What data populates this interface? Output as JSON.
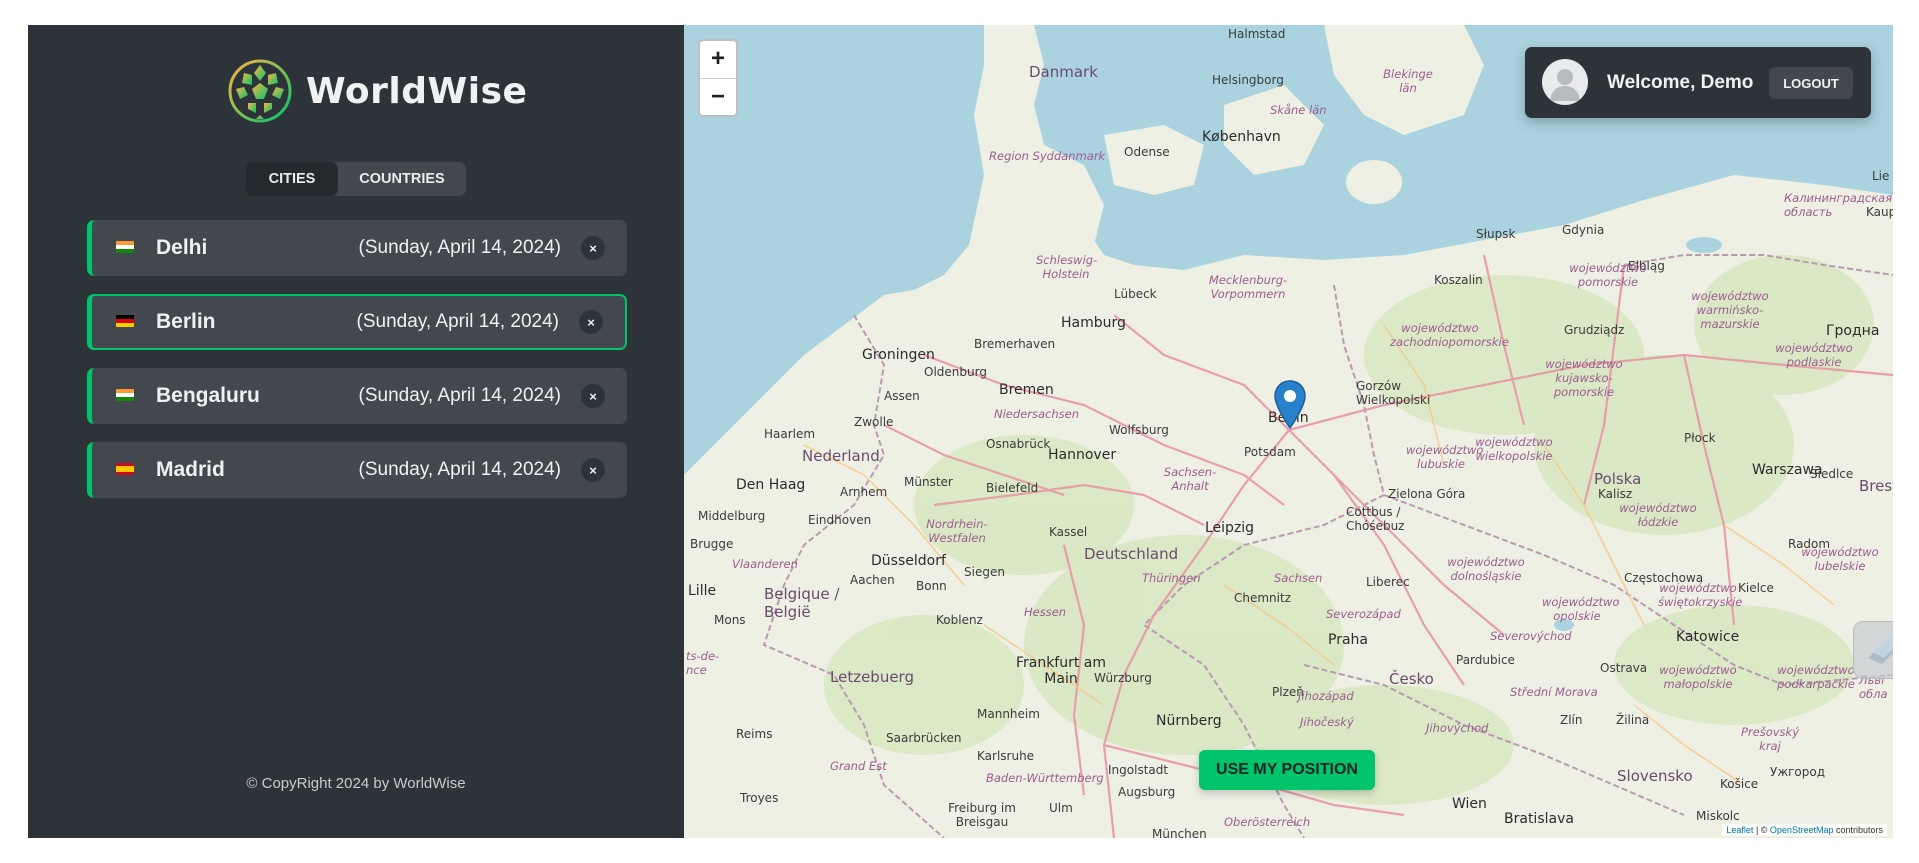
{
  "brand": {
    "name": "WorldWise",
    "logo_icon": "globe-logo-icon"
  },
  "tabs": [
    {
      "label": "Cities",
      "active": true
    },
    {
      "label": "Countries",
      "active": false
    }
  ],
  "cities": [
    {
      "name": "Delhi",
      "date": "(Sunday, April 14, 2024)",
      "flag": "in",
      "selected": false
    },
    {
      "name": "Berlin",
      "date": "(Sunday, April 14, 2024)",
      "flag": "de",
      "selected": true
    },
    {
      "name": "Bengaluru",
      "date": "(Sunday, April 14, 2024)",
      "flag": "in",
      "selected": false
    },
    {
      "name": "Madrid",
      "date": "(Sunday, April 14, 2024)",
      "flag": "es",
      "selected": false
    }
  ],
  "delete_symbol": "×",
  "footer": {
    "copyright": "© CopyRight 2024 by WorldWise"
  },
  "map": {
    "zoom_in": "+",
    "zoom_out": "−",
    "use_position": "Use my position",
    "attribution": {
      "leaflet": "Leaflet",
      "sep": " | © ",
      "osm": "OpenStreetMap",
      "suffix": " contributors"
    },
    "labels": {
      "countries": [
        "Danmark",
        "Nederland",
        "Deutschland",
        "Polska",
        "Belgique / België",
        "Letzebuerg",
        "Česko",
        "Slovensko",
        "Brest"
      ],
      "cities": [
        "København",
        "Hamburg",
        "Bremen",
        "Hannover",
        "Berlin",
        "Leipzig",
        "Praha",
        "Warszawa",
        "Wien",
        "Bratislava",
        "Katowice",
        "Düsseldorf",
        "Frankfurt am Main",
        "Den Haag",
        "Nürnberg",
        "Groningen",
        "Potsdam"
      ],
      "towns": [
        "Halmstad",
        "Helsingborg",
        "Odense",
        "Lübeck",
        "Bremerhaven",
        "Oldenburg",
        "Assen",
        "Zwolle",
        "Osnabrück",
        "Wolfsburg",
        "Haarlem",
        "Arnhem",
        "Münster",
        "Bielefeld",
        "Middelburg",
        "Eindhoven",
        "Kassel",
        "Brugge",
        "Aachen",
        "Bonn",
        "Siegen",
        "Lille",
        "Mons",
        "Koblenz",
        "Chemnitz",
        "Würzburg",
        "Mannheim",
        "Saarbrücken",
        "Karlsruhe",
        "Reims",
        "Troyes",
        "Freiburg im Breisgau",
        "Ulm",
        "Augsburg",
        "Ingolstadt",
        "München",
        "Plzeň",
        "Liberec",
        "Pardubice",
        "Ostrava",
        "Zlín",
        "Žilina",
        "Košice",
        "Ужгород",
        "Miskolc",
        "Radom",
        "Kielce",
        "Częstochowa",
        "Kalisz",
        "Płock",
        "Siedlce",
        "Słupsk",
        "Gdynia",
        "Elbląg",
        "Koszalin",
        "Grudziądz",
        "Gorzów Wielkopolski",
        "Zielona Góra",
        "Cottbus / Chóśebuz",
        "Гродна",
        "Kaup",
        "Lie"
      ],
      "regions": [
        "Region Syddanmark",
        "Skåne län",
        "Blekinge län",
        "Schleswig-Holstein",
        "Mecklenburg-Vorpommern",
        "Niedersachsen",
        "Sachsen-Anhalt",
        "Nordrhein-Westfalen",
        "Thüringen",
        "Sachsen",
        "Hessen",
        "Vlaanderen",
        "Grand Est",
        "Baden-Württemberg",
        "Oberösterreich",
        "Jihočeský",
        "Severovýchod",
        "Střední Morava",
        "Калининградская область",
        "województwo pomorskie",
        "województwo warmińsko-mazurskie",
        "województwo zachodniopomorskie",
        "województwo kujawsko-pomorskie",
        "województwo podlaskie",
        "województwo lubuskie",
        "województwo wielkopolskie",
        "województwo łódzkie",
        "województwo dolnośląskie",
        "województwo opolskie",
        "województwo świętokrzyskie",
        "województwo lubelskie",
        "województwo małopolskie",
        "województwo podkarpackie",
        "Prešovský kraj",
        "Jihozápad",
        "Jihovýchod",
        "Severozápad",
        "Льві обла",
        "ts-de-nce"
      ]
    }
  },
  "user": {
    "welcome": "Welcome, Demo",
    "logout": "Logout",
    "avatar_icon": "user-avatar-icon"
  },
  "colors": {
    "accent": "#00c46a",
    "panel": "#2d3439",
    "card": "#42484d",
    "sea": "#aad3df",
    "land": "#eef0e4",
    "forest": "#cfe5b4"
  }
}
